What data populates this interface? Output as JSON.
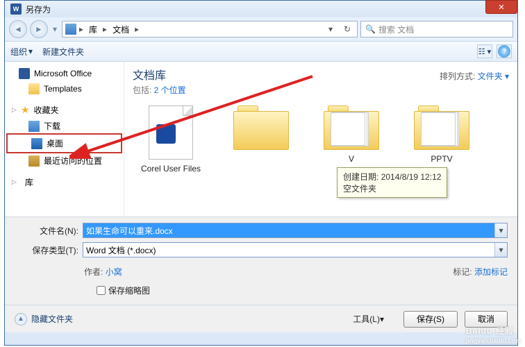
{
  "window": {
    "title": "另存为"
  },
  "nav": {
    "crumbs": [
      "库",
      "文档"
    ],
    "search_placeholder": "搜索 文档"
  },
  "toolbar": {
    "organize": "组织",
    "newfolder": "新建文件夹"
  },
  "sidebar": {
    "office": "Microsoft Office",
    "templates": "Templates",
    "favorites": "收藏夹",
    "downloads": "下载",
    "desktop": "桌面",
    "recent": "最近访问的位置",
    "libraries": "库"
  },
  "content": {
    "lib_title": "文档库",
    "lib_sub_prefix": "包括: ",
    "lib_sub_link": "2 个位置",
    "arrange_label": "排列方式: ",
    "arrange_value": "文件夹",
    "items": [
      {
        "name": "Corel User Files",
        "type": "file"
      },
      {
        "name": "",
        "type": "folder"
      },
      {
        "name": "V",
        "type": "multi"
      },
      {
        "name": "PPTV",
        "type": "multi"
      }
    ],
    "tooltip_line1": "创建日期: 2014/8/19 12:12",
    "tooltip_line2": "空文件夹"
  },
  "form": {
    "filename_label": "文件名(N):",
    "filename_value": "如果生命可以重来.docx",
    "filetype_label": "保存类型(T):",
    "filetype_value": "Word 文档 (*.docx)",
    "author_label": "作者:",
    "author_value": "小窝",
    "tags_label": "标记:",
    "tags_value": "添加标记",
    "thumb_label": "保存缩略图"
  },
  "footer": {
    "hide": "隐藏文件夹",
    "tools": "工具(L)",
    "save": "保存(S)",
    "cancel": "取消"
  },
  "watermark": {
    "brand": "Baidu 经验",
    "url": "jingyan.baidu.com"
  }
}
